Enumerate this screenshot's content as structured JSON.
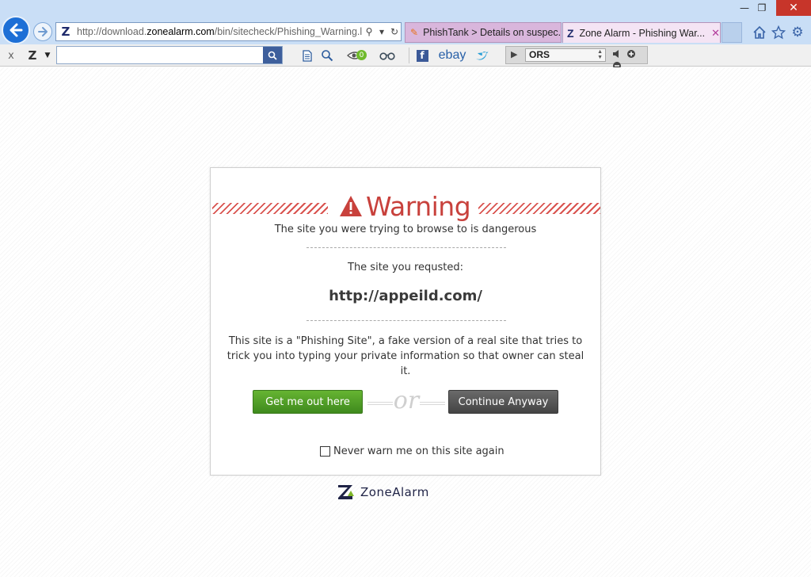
{
  "browser": {
    "window_controls": {
      "minimize": "—",
      "restore": "❐",
      "close": "✕"
    },
    "address_bar": {
      "url_prefix": "http://download.",
      "url_domain": "zonealarm.com",
      "url_suffix": "/bin/sitecheck/Phishing_Warning.l"
    },
    "tabs": [
      {
        "label": "PhishTank > Details on suspec...",
        "active": false
      },
      {
        "label": "Zone Alarm - Phishing War...",
        "active": true
      }
    ],
    "tab_close": "✕"
  },
  "toolbar": {
    "close_label": "x",
    "search_placeholder": "",
    "eye_badge_count": "0",
    "ebay_label": "ebay",
    "radio_station": "ORS"
  },
  "warning": {
    "heading": "Warning",
    "dangerous_text": "The site you were trying to browse to is dangerous",
    "requested_label": "The site you requsted:",
    "requested_url": "http://appeild.com/",
    "explanation": "This site is a \"Phishing Site\", a fake version of a real site that tries to trick you into typing your private information so that owner can steal it.",
    "get_out_label": "Get me out here",
    "or_text": "or",
    "continue_label": "Continue Anyway",
    "never_warn_label": "Never warn me on this site again",
    "never_warn_checked": false,
    "accent_color": "#c8413c",
    "get_out_color": "#4f9e26",
    "continue_color": "#555555"
  },
  "footer": {
    "logo_text": "ZoneAlarm"
  },
  "icons": {
    "back": "back-arrow-icon",
    "forward": "forward-arrow-icon",
    "home": "home-icon",
    "favorites": "star-icon",
    "tools": "gear-icon",
    "warning": "warning-triangle-icon"
  }
}
